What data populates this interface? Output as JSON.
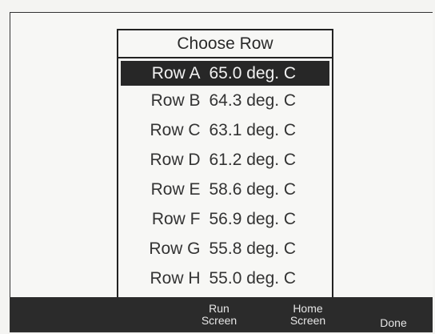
{
  "dialog": {
    "title": "Choose Row",
    "rows": [
      {
        "name": "Row A",
        "temp": "65.0 deg. C",
        "selected": true
      },
      {
        "name": "Row B",
        "temp": "64.3 deg. C"
      },
      {
        "name": "Row C",
        "temp": "63.1 deg. C"
      },
      {
        "name": "Row D",
        "temp": "61.2 deg. C"
      },
      {
        "name": "Row E",
        "temp": "58.6 deg. C"
      },
      {
        "name": "Row F",
        "temp": "56.9 deg. C"
      },
      {
        "name": "Row G",
        "temp": "55.8 deg. C"
      },
      {
        "name": "Row H",
        "temp": "55.0 deg. C"
      }
    ]
  },
  "softkeys": {
    "run": {
      "line1": "Run",
      "line2": "Screen"
    },
    "home": {
      "line1": "Home",
      "line2": "Screen"
    },
    "done": {
      "line1": "Done"
    }
  }
}
